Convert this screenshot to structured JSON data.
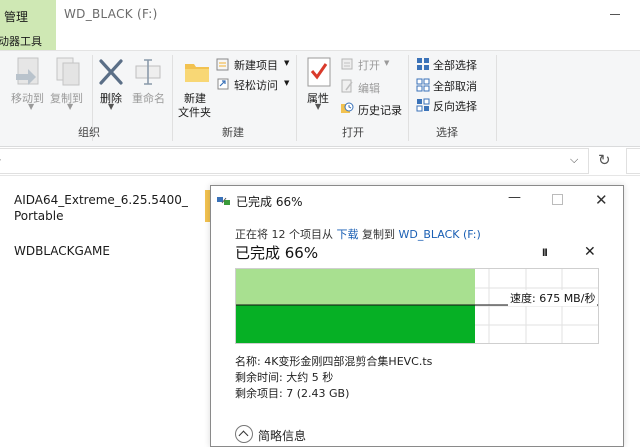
{
  "window": {
    "title": "WD_BLACK (F:)",
    "tab_manage": "管理",
    "tab_drive_tools": "动器工具"
  },
  "ribbon": {
    "organize": {
      "label": "组织",
      "move_to": "移动到",
      "copy_to": "复制到",
      "delete": "删除",
      "rename": "重命名"
    },
    "new": {
      "label": "新建",
      "new_item": "新建项目",
      "easy_access": "轻松访问",
      "new_folder_line1": "新建",
      "new_folder_line2": "文件夹"
    },
    "open": {
      "label": "打开",
      "properties": "属性",
      "open": "打开",
      "edit": "编辑",
      "history": "历史记录"
    },
    "select": {
      "label": "选择",
      "select_all": "全部选择",
      "select_none": "全部取消",
      "invert": "反向选择"
    }
  },
  "files": [
    {
      "line1": "AIDA64_Extreme_6.25.5400_",
      "line2": "Portable"
    },
    {
      "line1": "WDBLACKGAME",
      "line2": ""
    }
  ],
  "dialog": {
    "title": "已完成 66%",
    "status_prefix": "正在将 12 个项目从",
    "source": "下载",
    "status_mid": "复制到",
    "destination": "WD_BLACK (F:)",
    "big_status": "已完成 66%",
    "speed": "速度: 675 MB/秒",
    "name_label": "名称:",
    "name_value": "4K变形金刚四部混剪合集HEVC.ts",
    "time_label": "剩余时间:",
    "time_value": "大约 5 秒",
    "items_label": "剩余项目:",
    "items_value": "7 (2.43 GB)",
    "summary": "简略信息",
    "progress": 0.66,
    "colors": {
      "light_green": "#a8e090",
      "dark_green": "#06b025",
      "link": "#1a5fb4"
    }
  }
}
